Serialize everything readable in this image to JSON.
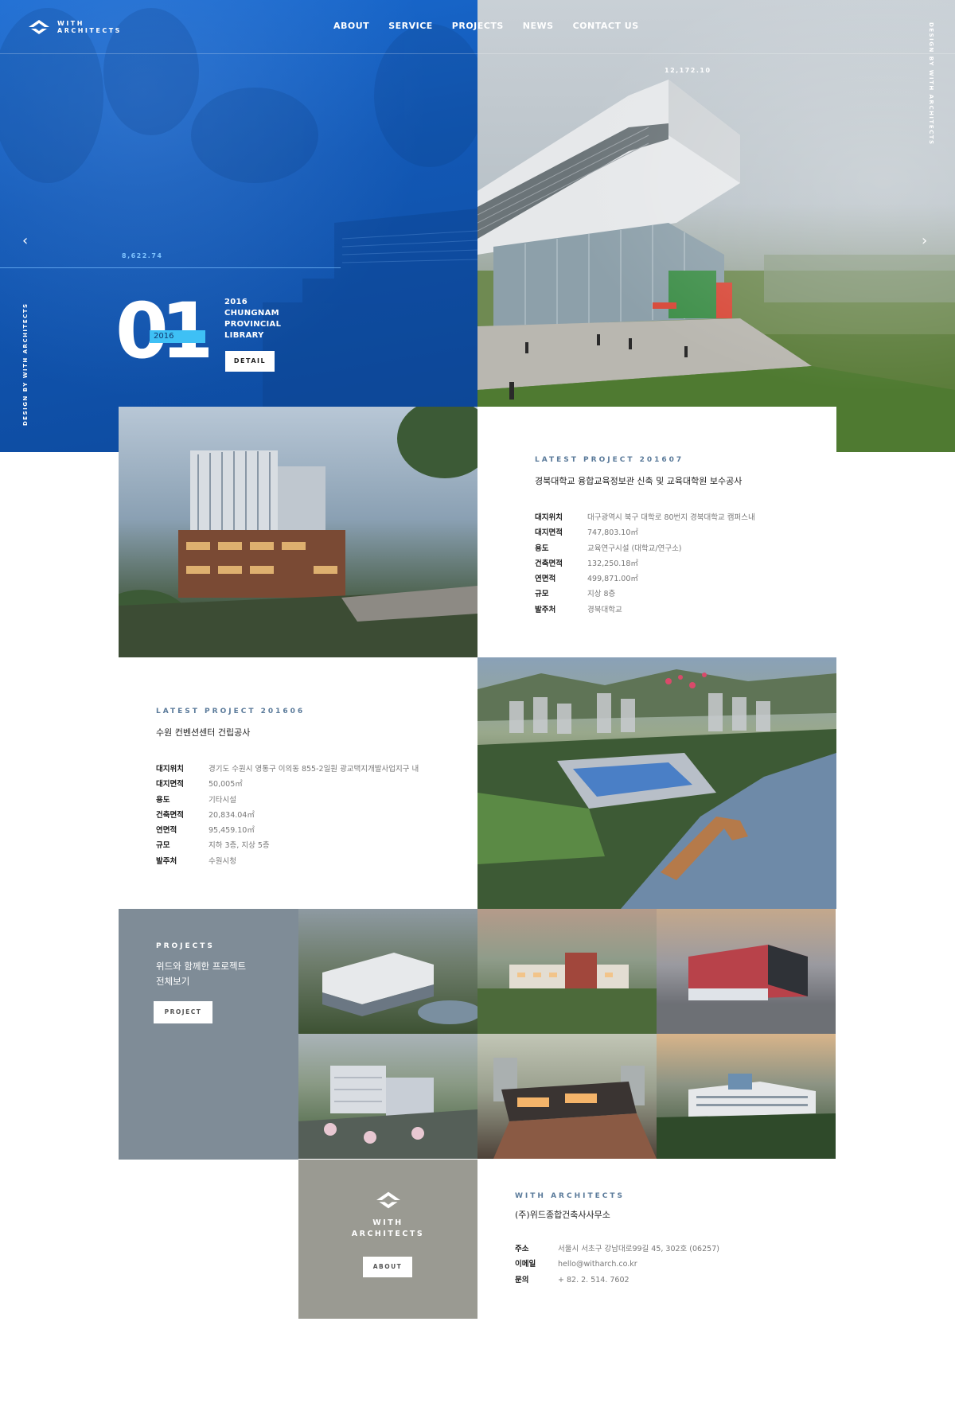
{
  "header": {
    "logo_line1": "WITH",
    "logo_line2": "ARCHITECTS",
    "nav": [
      "ABOUT",
      "SERVICE",
      "PROJECTS",
      "NEWS",
      "CONTACT US"
    ]
  },
  "hero": {
    "vertical_text": "DESIGN BY WITH ARCHITECTS",
    "coord_top": "12,172.10",
    "coord_left": "8,622.74",
    "slide_number": "01",
    "year_badge": "2016",
    "title_lines": [
      "2016",
      "CHUNGNAM",
      "PROVINCIAL",
      "LIBRARY"
    ],
    "detail_label": "DETAIL",
    "prev_icon": "‹",
    "next_icon": "›"
  },
  "project1": {
    "label": "LATEST PROJECT 201607",
    "title": "경북대학교 융합교육정보관 신축 및 교육대학원 보수공사",
    "rows": [
      {
        "key": "대지위치",
        "value": "대구광역시 북구 대학로 80번지 경북대학교 캠퍼스내"
      },
      {
        "key": "대지면적",
        "value": "747,803.10㎡"
      },
      {
        "key": "용도",
        "value": "교육연구시설 (대학교/연구소)"
      },
      {
        "key": "건축면적",
        "value": "132,250.18㎡"
      },
      {
        "key": "연면적",
        "value": "499,871.00㎡"
      },
      {
        "key": "규모",
        "value": "지상 8층"
      },
      {
        "key": "발주처",
        "value": "경북대학교"
      }
    ]
  },
  "project2": {
    "label": "LATEST PROJECT 201606",
    "title": "수원 컨벤션센터 건립공사",
    "rows": [
      {
        "key": "대지위치",
        "value": "경기도 수원시 영통구 이의동 855-2일원 광교택지개발사업지구 내"
      },
      {
        "key": "대지면적",
        "value": "50,005㎡"
      },
      {
        "key": "용도",
        "value": "기타시설"
      },
      {
        "key": "건축면적",
        "value": "20,834.04㎡"
      },
      {
        "key": "연면적",
        "value": "95,459.10㎡"
      },
      {
        "key": "규모",
        "value": "지하 3층, 지상 5층"
      },
      {
        "key": "발주처",
        "value": "수원시청"
      }
    ]
  },
  "projects": {
    "label": "PROJECTS",
    "desc_line1": "위드와 함께한 프로젝트",
    "desc_line2": "전체보기",
    "button": "PROJECT"
  },
  "footer": {
    "logo_line1": "WITH",
    "logo_line2": "ARCHITECTS",
    "about_button": "ABOUT",
    "label": "WITH ARCHITECTS",
    "company": "(주)위드종합건축사사무소",
    "rows": [
      {
        "key": "주소",
        "value": "서울시 서초구 강남대로99길 45, 302호 (06257)"
      },
      {
        "key": "이메일",
        "value": "hello@witharch.co.kr"
      },
      {
        "key": "문의",
        "value": "+ 82. 2. 514. 7602"
      }
    ]
  },
  "colors": {
    "brand_blue": "#1258b5",
    "accent_cyan": "#3ec0f5",
    "panel_gray": "#7f8c97",
    "footer_gray": "#9a9a92"
  }
}
